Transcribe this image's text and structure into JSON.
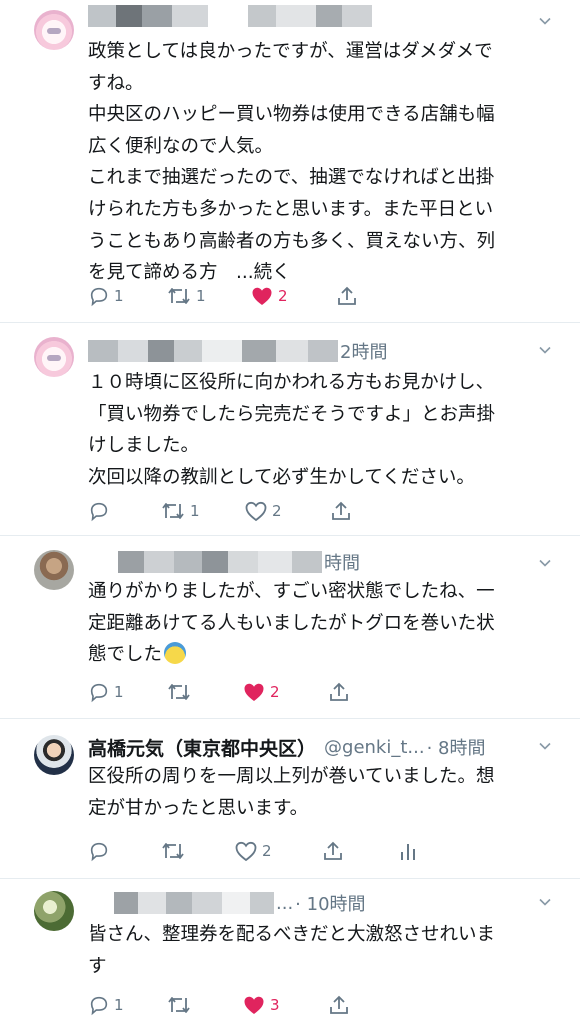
{
  "colors": {
    "text": "#14171a",
    "secondary": "#657786",
    "like": "#e0245e",
    "divider": "#e6ecf0"
  },
  "tweets": [
    {
      "avatar": "anime-character-avatar",
      "name": "",
      "handle": "",
      "time": "",
      "lines": [
        "政策としては良かったですが、運営はダメダメで",
        "すね。",
        "中央区のハッピー買い物券は使用できる店舗も幅",
        "広く便利なので人気。",
        "これまで抽選だったので、抽選でなければと出掛",
        "けられた方も多かったと思います。また平日とい",
        "うこともあり高齢者の方も多く、買えない方、列",
        "を見て諦める方　...続く"
      ],
      "reply": "1",
      "retweet": "1",
      "like": "2",
      "liked": true
    },
    {
      "avatar": "anime-character-avatar",
      "name": "",
      "handle": "",
      "time": "2時間",
      "lines": [
        "１０時頃に区役所に向かわれる方もお見かけし、",
        "「買い物券でしたら完売だそうですよ」とお声掛",
        "けしました。",
        "次回以降の教訓として必ず生かしてください。"
      ],
      "reply": "",
      "retweet": "1",
      "like": "2",
      "liked": false
    },
    {
      "avatar": "photo-avatar",
      "name": "",
      "handle": "",
      "time": "時間",
      "lines": [
        "通りがかりましたが、すごい密状態でしたね、一",
        "定距離あけてる人もいましたがトグロを巻いた状",
        "態でした"
      ],
      "reply": "1",
      "retweet": "",
      "like": "2",
      "liked": true
    },
    {
      "avatar": "person-avatar",
      "name": "高橋元気（東京都中央区）",
      "handle": "@genki_t...",
      "time": "· 8時間",
      "lines": [
        "区役所の周りを一周以上列が巻いていました。想",
        "定が甘かったと思います。"
      ],
      "reply": "",
      "retweet": "",
      "like": "2",
      "liked": false
    },
    {
      "avatar": "plant-avatar",
      "name": "",
      "handle": "...",
      "time": "· 10時間",
      "lines": [
        "皆さん、整理券を配るべきだと大激怒させれいま",
        "す"
      ],
      "reply": "1",
      "retweet": "",
      "like": "3",
      "liked": true
    }
  ]
}
